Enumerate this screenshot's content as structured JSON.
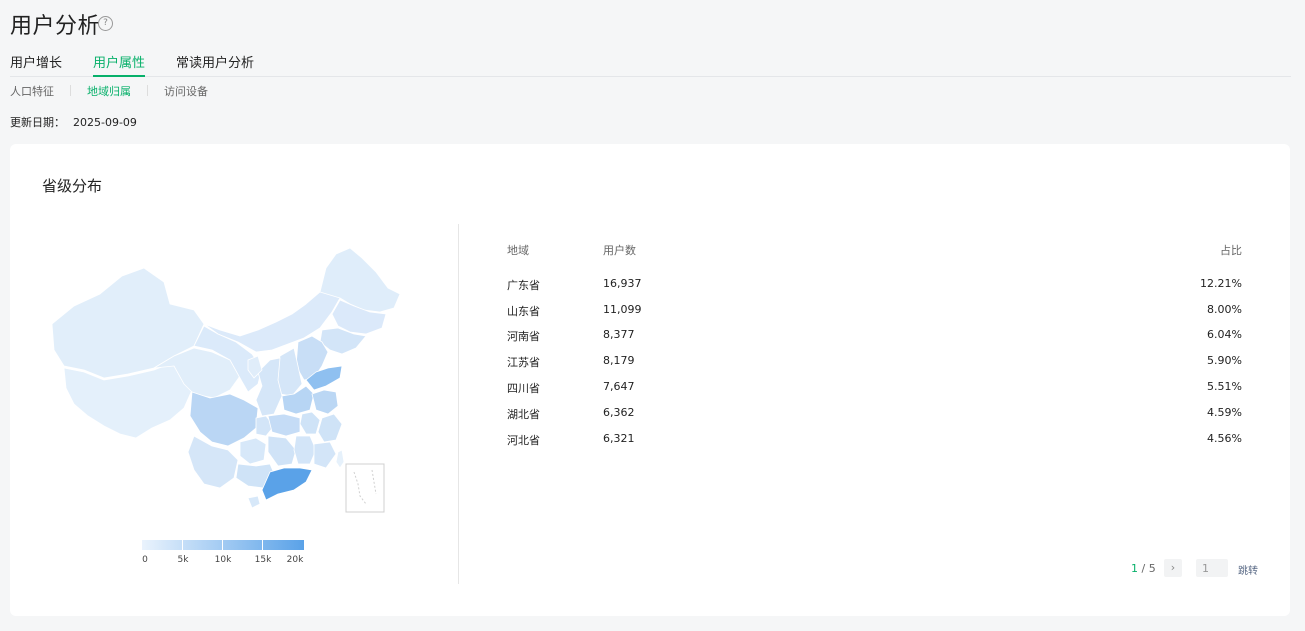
{
  "header": {
    "title": "用户分析",
    "help": "?"
  },
  "tabs": [
    {
      "label": "用户增长"
    },
    {
      "label": "用户属性"
    },
    {
      "label": "常读用户分析"
    }
  ],
  "subtabs": [
    {
      "label": "人口特征"
    },
    {
      "label": "地域归属"
    },
    {
      "label": "访问设备"
    }
  ],
  "update": {
    "label": "更新日期：",
    "date": "2025-09-09"
  },
  "card": {
    "title": "省级分布"
  },
  "legend": {
    "ticks": [
      "0",
      "5k",
      "10k",
      "15k",
      "20k"
    ],
    "min_color": "#eaf3fd",
    "max_color": "#5aa2e8"
  },
  "table": {
    "headers": {
      "region": "地域",
      "users": "用户数",
      "share": "占比"
    },
    "rows": [
      {
        "region": "广东省",
        "users": "16,937",
        "share": "12.21%"
      },
      {
        "region": "山东省",
        "users": "11,099",
        "share": "8.00%"
      },
      {
        "region": "河南省",
        "users": "8,377",
        "share": "6.04%"
      },
      {
        "region": "江苏省",
        "users": "8,179",
        "share": "5.90%"
      },
      {
        "region": "四川省",
        "users": "7,647",
        "share": "5.51%"
      },
      {
        "region": "湖北省",
        "users": "6,362",
        "share": "4.59%"
      },
      {
        "region": "河北省",
        "users": "6,321",
        "share": "4.56%"
      }
    ]
  },
  "pagination": {
    "current": "1",
    "separator": "/",
    "total": "5",
    "next": "›",
    "input_value": "1",
    "jump": "跳转"
  },
  "colors": {
    "accent": "#07b06a",
    "map_light": "#deecfa",
    "map_dark": "#5aa2e8"
  }
}
